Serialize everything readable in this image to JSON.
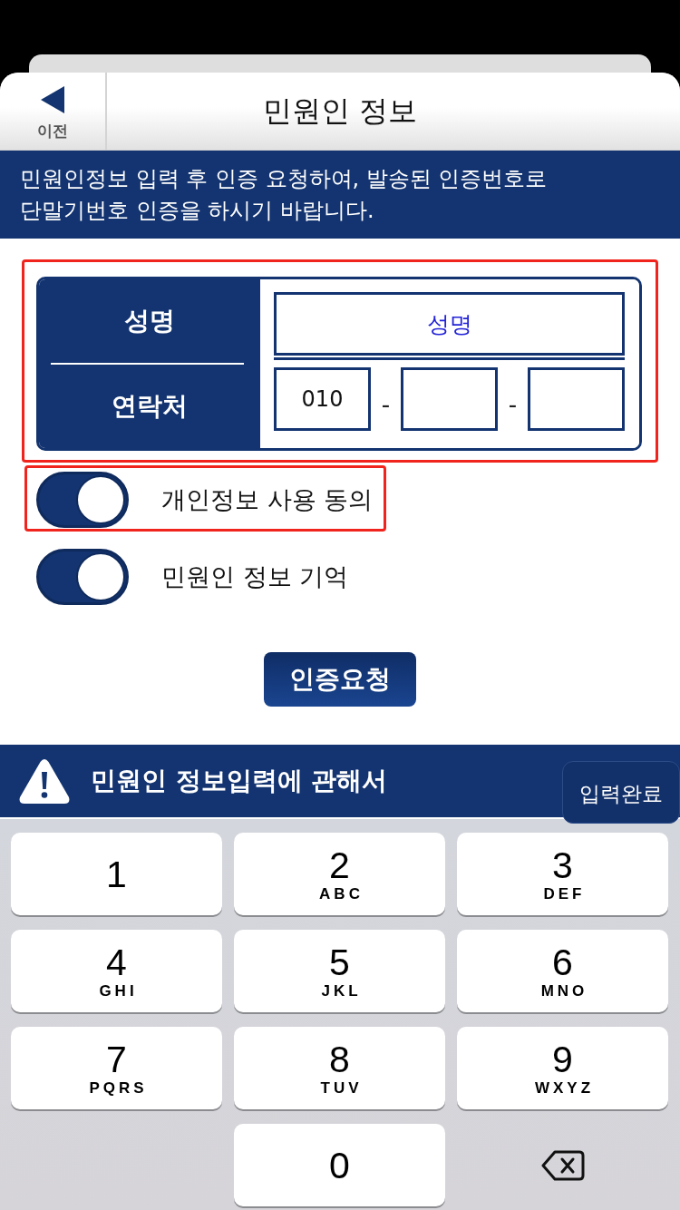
{
  "nav": {
    "back_label": "이전",
    "title": "민원인 정보"
  },
  "notice": "민원인정보 입력 후 인증 요청하여, 발송된 인증번호로 단말기번호 인증을 하시기 바랍니다.",
  "form": {
    "highlighted": true,
    "name_label": "성명",
    "name_field": {
      "placeholder": "성명"
    },
    "contact_label": "연락처",
    "phone_fields": [
      {
        "kind": "filled",
        "value": "010"
      },
      {
        "kind": "blank"
      },
      {
        "kind": "blank"
      }
    ],
    "separators": [
      "-",
      "-"
    ]
  },
  "toggles": [
    {
      "label": "개인정보 사용 동의",
      "on": true,
      "highlighted": true
    },
    {
      "label": "민원인 정보 기억",
      "on": true,
      "highlighted": false
    }
  ],
  "request_button": "인증요청",
  "notice_bar": {
    "title": "민원인 정보입력에 관해서"
  },
  "done_button": "입력완료",
  "keypad": {
    "keys": [
      {
        "kind": "digit",
        "digit": "1"
      },
      {
        "kind": "digit",
        "digit": "2",
        "letters": "ABC"
      },
      {
        "kind": "digit",
        "digit": "3",
        "letters": "DEF"
      },
      {
        "kind": "digit",
        "digit": "4",
        "letters": "GHI"
      },
      {
        "kind": "digit",
        "digit": "5",
        "letters": "JKL"
      },
      {
        "kind": "digit",
        "digit": "6",
        "letters": "MNO"
      },
      {
        "kind": "digit",
        "digit": "7",
        "letters": "PQRS"
      },
      {
        "kind": "digit",
        "digit": "8",
        "letters": "TUV"
      },
      {
        "kind": "digit",
        "digit": "9",
        "letters": "WXYZ"
      },
      {
        "kind": "empty"
      },
      {
        "kind": "digit",
        "digit": "0"
      },
      {
        "kind": "delete"
      }
    ]
  }
}
